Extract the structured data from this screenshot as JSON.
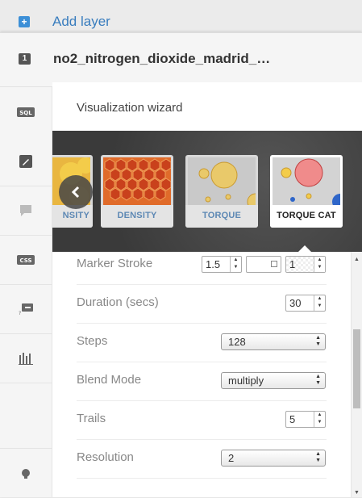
{
  "topbar": {
    "add_icon": "+",
    "add_label": "Add layer"
  },
  "layer": {
    "number": "1",
    "name": "no2_nitrogen_dioxide_madrid_…"
  },
  "tools": [
    "sql-icon",
    "wizard-icon",
    "infowindow-icon",
    "css-icon",
    "legend-icon",
    "filters-icon",
    "edit-icon"
  ],
  "wizard": {
    "title": "Visualization wizard",
    "cards": [
      {
        "label": "NSITY"
      },
      {
        "label": "DENSITY"
      },
      {
        "label": "TORQUE"
      },
      {
        "label": "TORQUE CAT",
        "selected": true
      }
    ],
    "properties": [
      {
        "label": "Marker Stroke",
        "width_value": "1.5",
        "color": "",
        "opacity": "1"
      },
      {
        "label": "Duration (secs)",
        "value": "30"
      },
      {
        "label": "Steps",
        "value": "128"
      },
      {
        "label": "Blend Mode",
        "value": "multiply"
      },
      {
        "label": "Trails",
        "value": "5"
      },
      {
        "label": "Resolution",
        "value": "2"
      }
    ]
  },
  "colors": {
    "accent": "#397dbe",
    "selected_cap_text": "#222222",
    "card_cap_text": "#5d88b4"
  }
}
